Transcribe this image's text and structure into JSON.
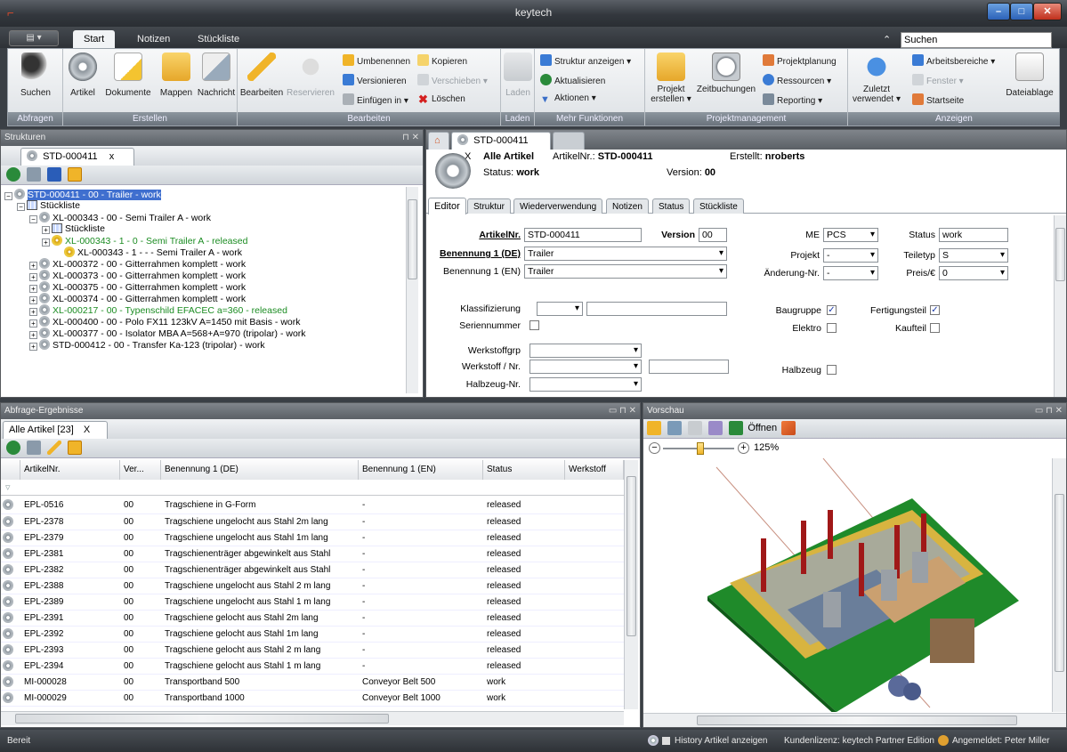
{
  "window": {
    "title": "keytech",
    "logo": "⌐",
    "min": "–",
    "max": "□",
    "close": "✕"
  },
  "ribbon_tabs": [
    "Start",
    "Notizen",
    "Stückliste"
  ],
  "app_menu": "▤ ▾",
  "search": {
    "label": "⌃",
    "value": "Suchen"
  },
  "ribbon": {
    "abfragen": {
      "label": "Abfragen",
      "suchen": "Suchen"
    },
    "erstellen": {
      "label": "Erstellen",
      "artikel": "Artikel",
      "dokumente": "Dokumente",
      "mappen": "Mappen",
      "nachricht": "Nachricht"
    },
    "bearbeiten": {
      "label": "Bearbeiten",
      "bearbeiten": "Bearbeiten",
      "reservieren": "Reservieren",
      "umbenennen": "Umbenennen",
      "versionieren": "Versionieren",
      "einfuegen": "Einfügen in ▾",
      "kopieren": "Kopieren",
      "verschieben": "Verschieben ▾",
      "loeschen": "Löschen"
    },
    "laden": {
      "label": "Laden",
      "laden": "Laden"
    },
    "mehr": {
      "label": "Mehr Funktionen",
      "struktur": "Struktur anzeigen ▾",
      "aktualisieren": "Aktualisieren",
      "aktionen": "Aktionen ▾"
    },
    "projekt": {
      "label": "Projektmanagement",
      "projekt1": "Projekt",
      "projekt2": "erstellen ▾",
      "zeit": "Zeitbuchungen",
      "planung": "Projektplanung",
      "ressourcen": "Ressourcen ▾",
      "reporting": "Reporting ▾"
    },
    "anzeigen": {
      "label": "Anzeigen",
      "zuletzt1": "Zuletzt",
      "zuletzt2": "verwendet ▾",
      "arbeitsbereiche": "Arbeitsbereiche ▾",
      "fenster": "Fenster ▾",
      "startseite": "Startseite",
      "dateiablage": "Dateiablage"
    }
  },
  "strukturen": {
    "title": "Strukturen",
    "pin": "⊓ ✕",
    "tab": "STD-000411",
    "tab_close": "x",
    "rows": [
      {
        "text": "STD-000411 - 00 - Trailer - work",
        "indent": 0,
        "exp": "−",
        "icon": "gear",
        "style": "sel"
      },
      {
        "text": "Stückliste",
        "indent": 1,
        "exp": "−",
        "icon": "grid",
        "style": ""
      },
      {
        "text": "XL-000343 - 00 - Semi Trailer A - work",
        "indent": 2,
        "exp": "−",
        "icon": "gear",
        "style": ""
      },
      {
        "text": "Stückliste",
        "indent": 3,
        "exp": "+",
        "icon": "grid",
        "style": ""
      },
      {
        "text": "XL-000343 - 1 - 0 - Semi Trailer A - released",
        "indent": 3,
        "exp": "+",
        "icon": "gearflag",
        "style": "green"
      },
      {
        "text": "XL-000343 - 1 - - - Semi Trailer A - work",
        "indent": 4,
        "exp": "",
        "icon": "gearflag",
        "style": ""
      },
      {
        "text": "XL-000372 - 00 - Gitterrahmen komplett - work",
        "indent": 2,
        "exp": "+",
        "icon": "gear",
        "style": ""
      },
      {
        "text": "XL-000373 - 00 - Gitterrahmen komplett - work",
        "indent": 2,
        "exp": "+",
        "icon": "gear",
        "style": ""
      },
      {
        "text": "XL-000375 - 00 - Gitterrahmen komplett - work",
        "indent": 2,
        "exp": "+",
        "icon": "gear",
        "style": ""
      },
      {
        "text": "XL-000374 - 00 - Gitterrahmen komplett - work",
        "indent": 2,
        "exp": "+",
        "icon": "gear",
        "style": ""
      },
      {
        "text": "XL-000217 - 00 - Typenschild EFACEC  a=360 - released",
        "indent": 2,
        "exp": "+",
        "icon": "gear",
        "style": "green"
      },
      {
        "text": "XL-000400 - 00 - Polo FX11 123kV A=1450 mit Basis - work",
        "indent": 2,
        "exp": "+",
        "icon": "gear",
        "style": ""
      },
      {
        "text": "XL-000377 - 00 - Isolator MBA A=568+A=970 (tripolar) - work",
        "indent": 2,
        "exp": "+",
        "icon": "gear",
        "style": ""
      },
      {
        "text": "STD-000412 - 00 - Transfer Ka-123 (tripolar) - work",
        "indent": 2,
        "exp": "+",
        "icon": "gear",
        "style": ""
      }
    ]
  },
  "detail": {
    "tab": "STD-000411",
    "tab_close": "X",
    "header": {
      "title": "Alle Artikel",
      "artikelnr_label": "ArtikelNr.:",
      "artikelnr": "STD-000411",
      "erstellt_label": "Erstellt:",
      "erstellt": "nroberts",
      "status_label": "Status:",
      "status": "work",
      "version_label": "Version:",
      "version": "00"
    },
    "subtabs": [
      "Editor",
      "Struktur",
      "Wiederverwendung",
      "Notizen",
      "Status",
      "Stückliste"
    ],
    "fields": {
      "artikelnr_label": "ArtikelNr.",
      "artikelnr": "STD-000411",
      "version_label": "Version",
      "version": "00",
      "ben_de_label": "Benennung 1 (DE)",
      "ben_de": "Trailer",
      "ben_en_label": "Benennung 1 (EN)",
      "ben_en": "Trailer",
      "me_label": "ME",
      "me": "PCS",
      "status_label": "Status",
      "status": "work",
      "projekt_label": "Projekt",
      "projekt": "-",
      "teiletyp_label": "Teiletyp",
      "teiletyp": "S",
      "aenderung_label": "Änderung-Nr.",
      "aenderung": "-",
      "preis_label": "Preis/€",
      "preis": "0",
      "klass_label": "Klassifizierung",
      "serien_label": "Seriennummer",
      "baugruppe_label": "Baugruppe",
      "fertigung_label": "Fertigungsteil",
      "elektro_label": "Elektro",
      "kaufteil_label": "Kaufteil",
      "wgrp_label": "Werkstoffgrp",
      "werkstoff_label": "Werkstoff / Nr.",
      "halbzeug_label": "Halbzeug",
      "halbzeugnr_label": "Halbzeug-Nr.",
      "check": "✓"
    }
  },
  "results": {
    "title": "Abfrage-Ergebnisse",
    "pin": "▭ ⊓ ✕",
    "tab": "Alle Artikel [23]",
    "tab_close": "X",
    "columns": [
      "ArtikelNr.",
      "Ver...",
      "Benennung 1 (DE)",
      "Benennung 1 (EN)",
      "Status",
      "Werkstoff"
    ],
    "rows": [
      [
        "EPL-0516",
        "00",
        "Tragschiene in G-Form",
        "-",
        "released"
      ],
      [
        "EPL-2378",
        "00",
        "Tragschiene ungelocht aus Stahl 2m lang",
        "-",
        "released"
      ],
      [
        "EPL-2379",
        "00",
        "Tragschiene ungelocht aus Stahl 1m lang",
        "-",
        "released"
      ],
      [
        "EPL-2381",
        "00",
        "Tragschienenträger abgewinkelt aus Stahl",
        "-",
        "released"
      ],
      [
        "EPL-2382",
        "00",
        "Tragschienenträger abgewinkelt aus Stahl",
        "-",
        "released"
      ],
      [
        "EPL-2388",
        "00",
        "Tragschiene ungelocht aus Stahl 2 m lang",
        "-",
        "released"
      ],
      [
        "EPL-2389",
        "00",
        "Tragschiene ungelocht aus Stahl 1 m lang",
        "-",
        "released"
      ],
      [
        "EPL-2391",
        "00",
        "Tragschiene gelocht aus Stahl 2m lang",
        "-",
        "released"
      ],
      [
        "EPL-2392",
        "00",
        "Tragschiene gelocht aus Stahl 1m lang",
        "-",
        "released"
      ],
      [
        "EPL-2393",
        "00",
        "Tragschiene gelocht aus Stahl 2 m lang",
        "-",
        "released"
      ],
      [
        "EPL-2394",
        "00",
        "Tragschiene gelocht aus Stahl 1 m lang",
        "-",
        "released"
      ],
      [
        "MI-000028",
        "00",
        "Transportband 500",
        "Conveyor Belt 500",
        "work"
      ],
      [
        "MI-000029",
        "00",
        "Transportband 1000",
        "Conveyor Belt 1000",
        "work"
      ]
    ]
  },
  "preview": {
    "title": "Vorschau",
    "pin": "▭ ⊓ ✕",
    "open": "Öffnen",
    "zoom": "125%",
    "minus": "−",
    "plus": "+"
  },
  "statusbar": {
    "left": "Bereit",
    "history": "History Artikel anzeigen",
    "license": "Kundenlizenz: keytech Partner Edition",
    "user": "Angemeldet: Peter Miller"
  }
}
